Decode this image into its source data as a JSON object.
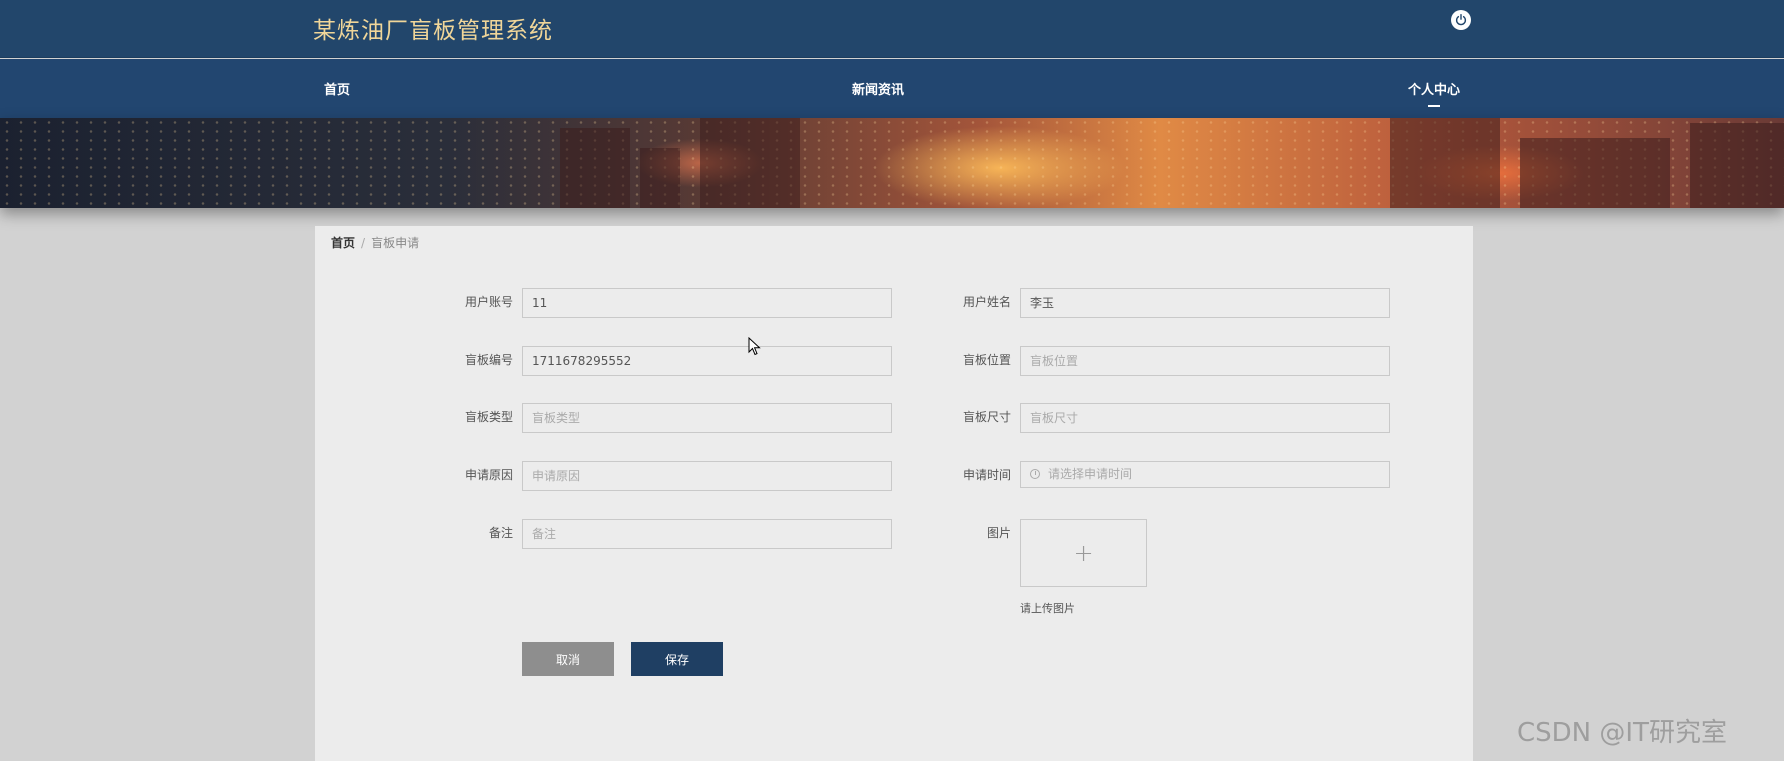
{
  "header": {
    "title": "某炼油厂盲板管理系统"
  },
  "nav": {
    "items": [
      {
        "label": "首页"
      },
      {
        "label": "新闻资讯"
      },
      {
        "label": "个人中心"
      }
    ],
    "active": "个人中心"
  },
  "breadcrumb": {
    "home": "首页",
    "separator": "/",
    "current": "盲板申请"
  },
  "form": {
    "user_account": {
      "label": "用户账号",
      "value": "11"
    },
    "user_name": {
      "label": "用户姓名",
      "value": "李玉"
    },
    "blind_number": {
      "label": "盲板编号",
      "value": "1711678295552"
    },
    "blind_location": {
      "label": "盲板位置",
      "placeholder": "盲板位置"
    },
    "blind_type": {
      "label": "盲板类型",
      "placeholder": "盲板类型"
    },
    "blind_size": {
      "label": "盲板尺寸",
      "placeholder": "盲板尺寸"
    },
    "reason": {
      "label": "申请原因",
      "placeholder": "申请原因"
    },
    "apply_time": {
      "label": "申请时间",
      "placeholder": "请选择申请时间"
    },
    "remark": {
      "label": "备注",
      "placeholder": "备注"
    },
    "image": {
      "label": "图片",
      "plus": "+",
      "hint": "请上传图片"
    }
  },
  "buttons": {
    "cancel": "取消",
    "save": "保存"
  },
  "watermark": "CSDN @IT研究室",
  "colors": {
    "header_bg": "#22466b",
    "title_gold": "#f0d699",
    "save_btn": "#1f3f63",
    "cancel_btn": "#8e8e8e"
  }
}
